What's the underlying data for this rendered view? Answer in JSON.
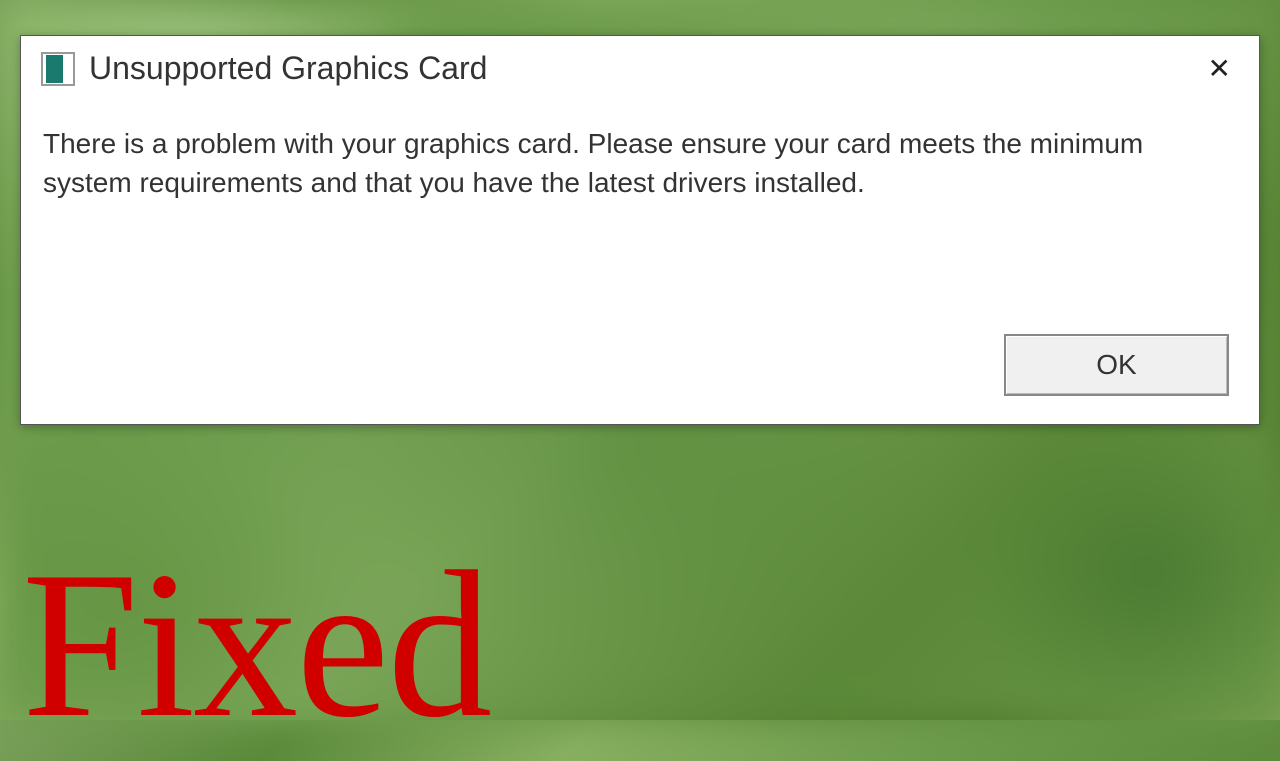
{
  "dialog": {
    "title": "Unsupported Graphics Card",
    "icon_name": "app-icon",
    "message": "There is a problem with your graphics card. Please ensure your card meets the minimum system requirements and that you have the latest drivers installed.",
    "close_label": "✕",
    "ok_label": "OK"
  },
  "overlay": {
    "caption": "Fixed"
  },
  "colors": {
    "caption_color": "#d00000",
    "background_tone": "#6a9a4a"
  }
}
